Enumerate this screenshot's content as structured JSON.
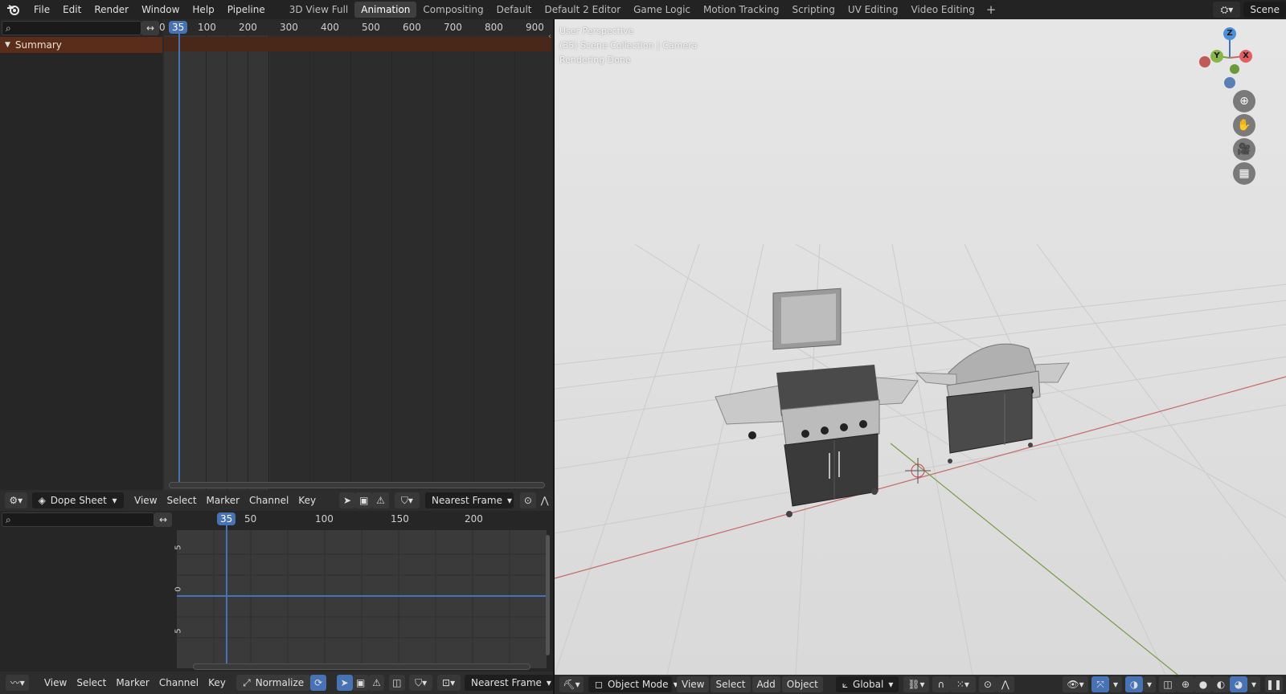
{
  "menu": {
    "items": [
      "File",
      "Edit",
      "Render",
      "Window",
      "Help",
      "Pipeline"
    ]
  },
  "workspaces": {
    "tabs": [
      "3D View Full",
      "Animation",
      "Compositing",
      "Default",
      "Default 2 Editor",
      "Game Logic",
      "Motion Tracking",
      "Scripting",
      "UV Editing",
      "Video Editing"
    ],
    "active": "Animation",
    "add_label": "+"
  },
  "scene": {
    "name": "Scene"
  },
  "dope_sheet": {
    "summary_label": "Summary",
    "current_frame": "35",
    "ruler_start": "0",
    "ruler_ticks": [
      "100",
      "200",
      "300",
      "400",
      "500",
      "600",
      "700",
      "800",
      "900"
    ],
    "header": {
      "editor_type": "Dope Sheet",
      "menus": [
        "View",
        "Select",
        "Marker",
        "Channel",
        "Key"
      ],
      "snap_mode": "Nearest Frame"
    }
  },
  "graph_editor": {
    "current_frame": "35",
    "ruler_ticks": [
      "50",
      "100",
      "150",
      "200"
    ],
    "y_ticks": [
      "5",
      "0",
      "5"
    ],
    "header": {
      "menus": [
        "View",
        "Select",
        "Marker",
        "Channel",
        "Key"
      ],
      "normalize_label": "Normalize",
      "snap_mode": "Nearest Frame"
    }
  },
  "viewport": {
    "overlay_lines": [
      "User Perspective",
      "(35) Scene Collection | Camera",
      "Rendering Done"
    ],
    "gizmo_axes": [
      "Z",
      "Y",
      "X"
    ],
    "header": {
      "mode": "Object Mode",
      "menus": [
        "View",
        "Select",
        "Add",
        "Object"
      ],
      "orientation": "Global"
    }
  },
  "colors": {
    "accent": "#4772b3",
    "summary_bg": "#5a2d1a",
    "x_axis": "#c46a6a",
    "y_axis": "#7a9a4a",
    "z_axis": "#4772b3"
  }
}
